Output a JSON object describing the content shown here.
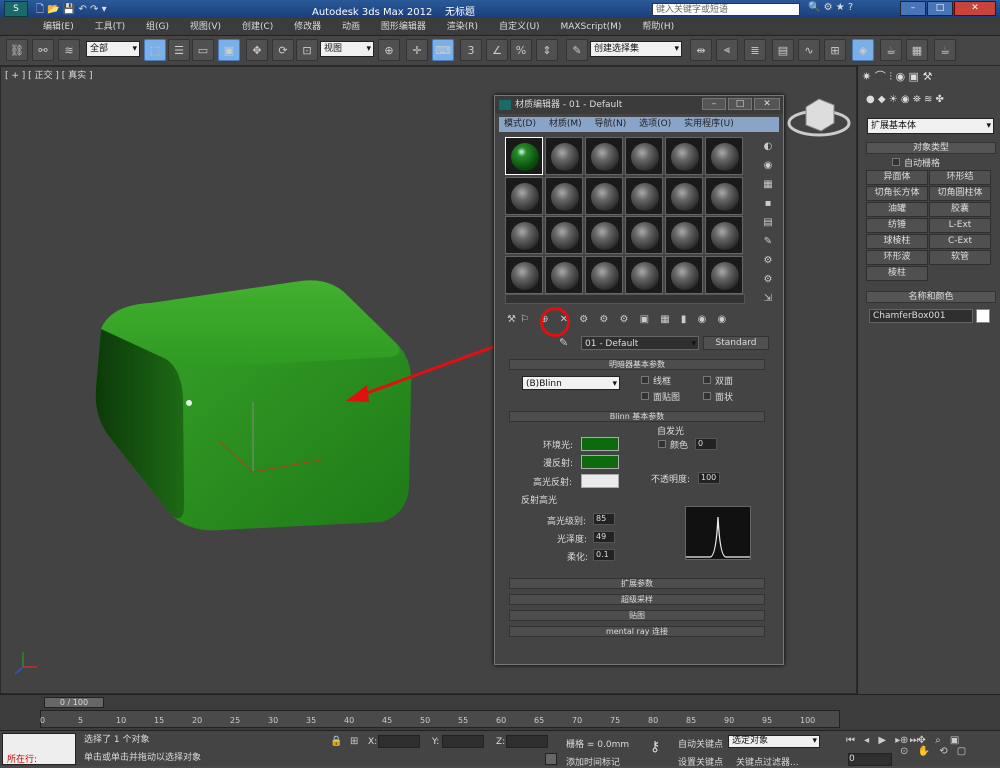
{
  "title": {
    "app": "Autodesk 3ds Max",
    "version": "2012",
    "file": "无标题",
    "search_placeholder": "键入关键字或短语"
  },
  "menu": [
    "编辑(E)",
    "工具(T)",
    "组(G)",
    "视图(V)",
    "创建(C)",
    "修改器",
    "动画",
    "图形编辑器",
    "渲染(R)",
    "自定义(U)",
    "MAXScript(M)",
    "帮助(H)"
  ],
  "toolbar": {
    "filter": "全部",
    "refcoord": "视图",
    "selset": "创建选择集"
  },
  "viewport": {
    "label": "[ + ] [ 正交 ] [ 真实 ]"
  },
  "medit": {
    "title": "材质编辑器 - 01 - Default",
    "menu": [
      "模式(D)",
      "材质(M)",
      "导航(N)",
      "选项(O)",
      "实用程序(U)"
    ],
    "material_name": "01 - Default",
    "material_type": "Standard",
    "shader_rollout": "明暗器基本参数",
    "shader": "(B)Blinn",
    "opt_wire": "线框",
    "opt_2side": "双面",
    "opt_facemap": "面贴图",
    "opt_faceted": "面状",
    "blinn_rollout": "Blinn 基本参数",
    "self_illum": "自发光",
    "color": "颜色",
    "color_val": "0",
    "ambient": "环境光:",
    "diffuse": "漫反射:",
    "specular": "高光反射:",
    "opacity": "不透明度:",
    "opacity_val": "100",
    "spec_hl": "反射高光",
    "spec_level": "高光级别:",
    "spec_level_val": "85",
    "gloss": "光泽度:",
    "gloss_val": "49",
    "soften": "柔化:",
    "soften_val": "0.1",
    "rollouts": [
      "扩展参数",
      "超级采样",
      "贴图",
      "mental ray 连接"
    ],
    "colors": {
      "ambient": "#0d6b0d",
      "diffuse": "#0d6b0d",
      "specular": "#ebebeb"
    }
  },
  "cmdpanel": {
    "category": "扩展基本体",
    "obj_type": "对象类型",
    "autogrid": "自动栅格",
    "buttons": [
      "异面体",
      "环形结",
      "切角长方体",
      "切角圆柱体",
      "油罐",
      "胶囊",
      "纺锤",
      "L-Ext",
      "球棱柱",
      "C-Ext",
      "环形波",
      "软管",
      "棱柱"
    ],
    "name_color": "名称和颜色",
    "obj_name": "ChamferBox001"
  },
  "timeline": {
    "frame": "0 / 100",
    "ticks": [
      "0",
      "5",
      "10",
      "15",
      "20",
      "25",
      "30",
      "35",
      "40",
      "45",
      "50",
      "55",
      "60",
      "65",
      "70",
      "75",
      "80",
      "85",
      "90",
      "95",
      "100"
    ]
  },
  "status": {
    "selected": "选择了 1 个对象",
    "prompt": "单击或单击并拖动以选择对象",
    "x": "X:",
    "y": "Y:",
    "z": "Z:",
    "grid": "栅格 = 0.0mm",
    "addtime": "添加时间标记",
    "autokey": "自动关键点",
    "selobj": "选定对象",
    "setkey": "设置关键点",
    "keyfilter": "关键点过滤器...",
    "mini": "所在行:",
    "frame_val": "0"
  }
}
